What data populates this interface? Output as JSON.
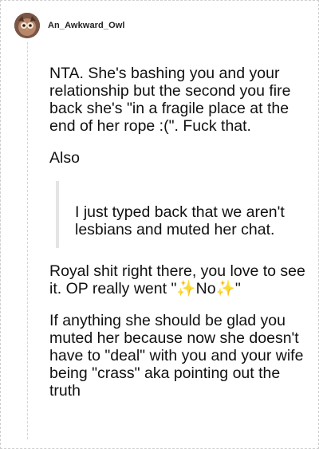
{
  "post": {
    "username": "An_Awkward_Owl",
    "avatar_icon": "owl-avatar-icon",
    "paragraphs": {
      "p1": "NTA. She's bashing you and your relationship but the second you fire back she's \"in a fragile place at the end of her rope :(\". Fuck that.",
      "p2": "Also",
      "quote": "I just typed back that we aren't lesbians and muted her chat.",
      "p3": "Royal shit right there, you love to see it. OP really went \"✨No✨\"",
      "p4": "If anything she should be glad you muted her because now she doesn't have to \"deal\" with you and your wife being \"crass\" aka pointing out the truth"
    }
  }
}
